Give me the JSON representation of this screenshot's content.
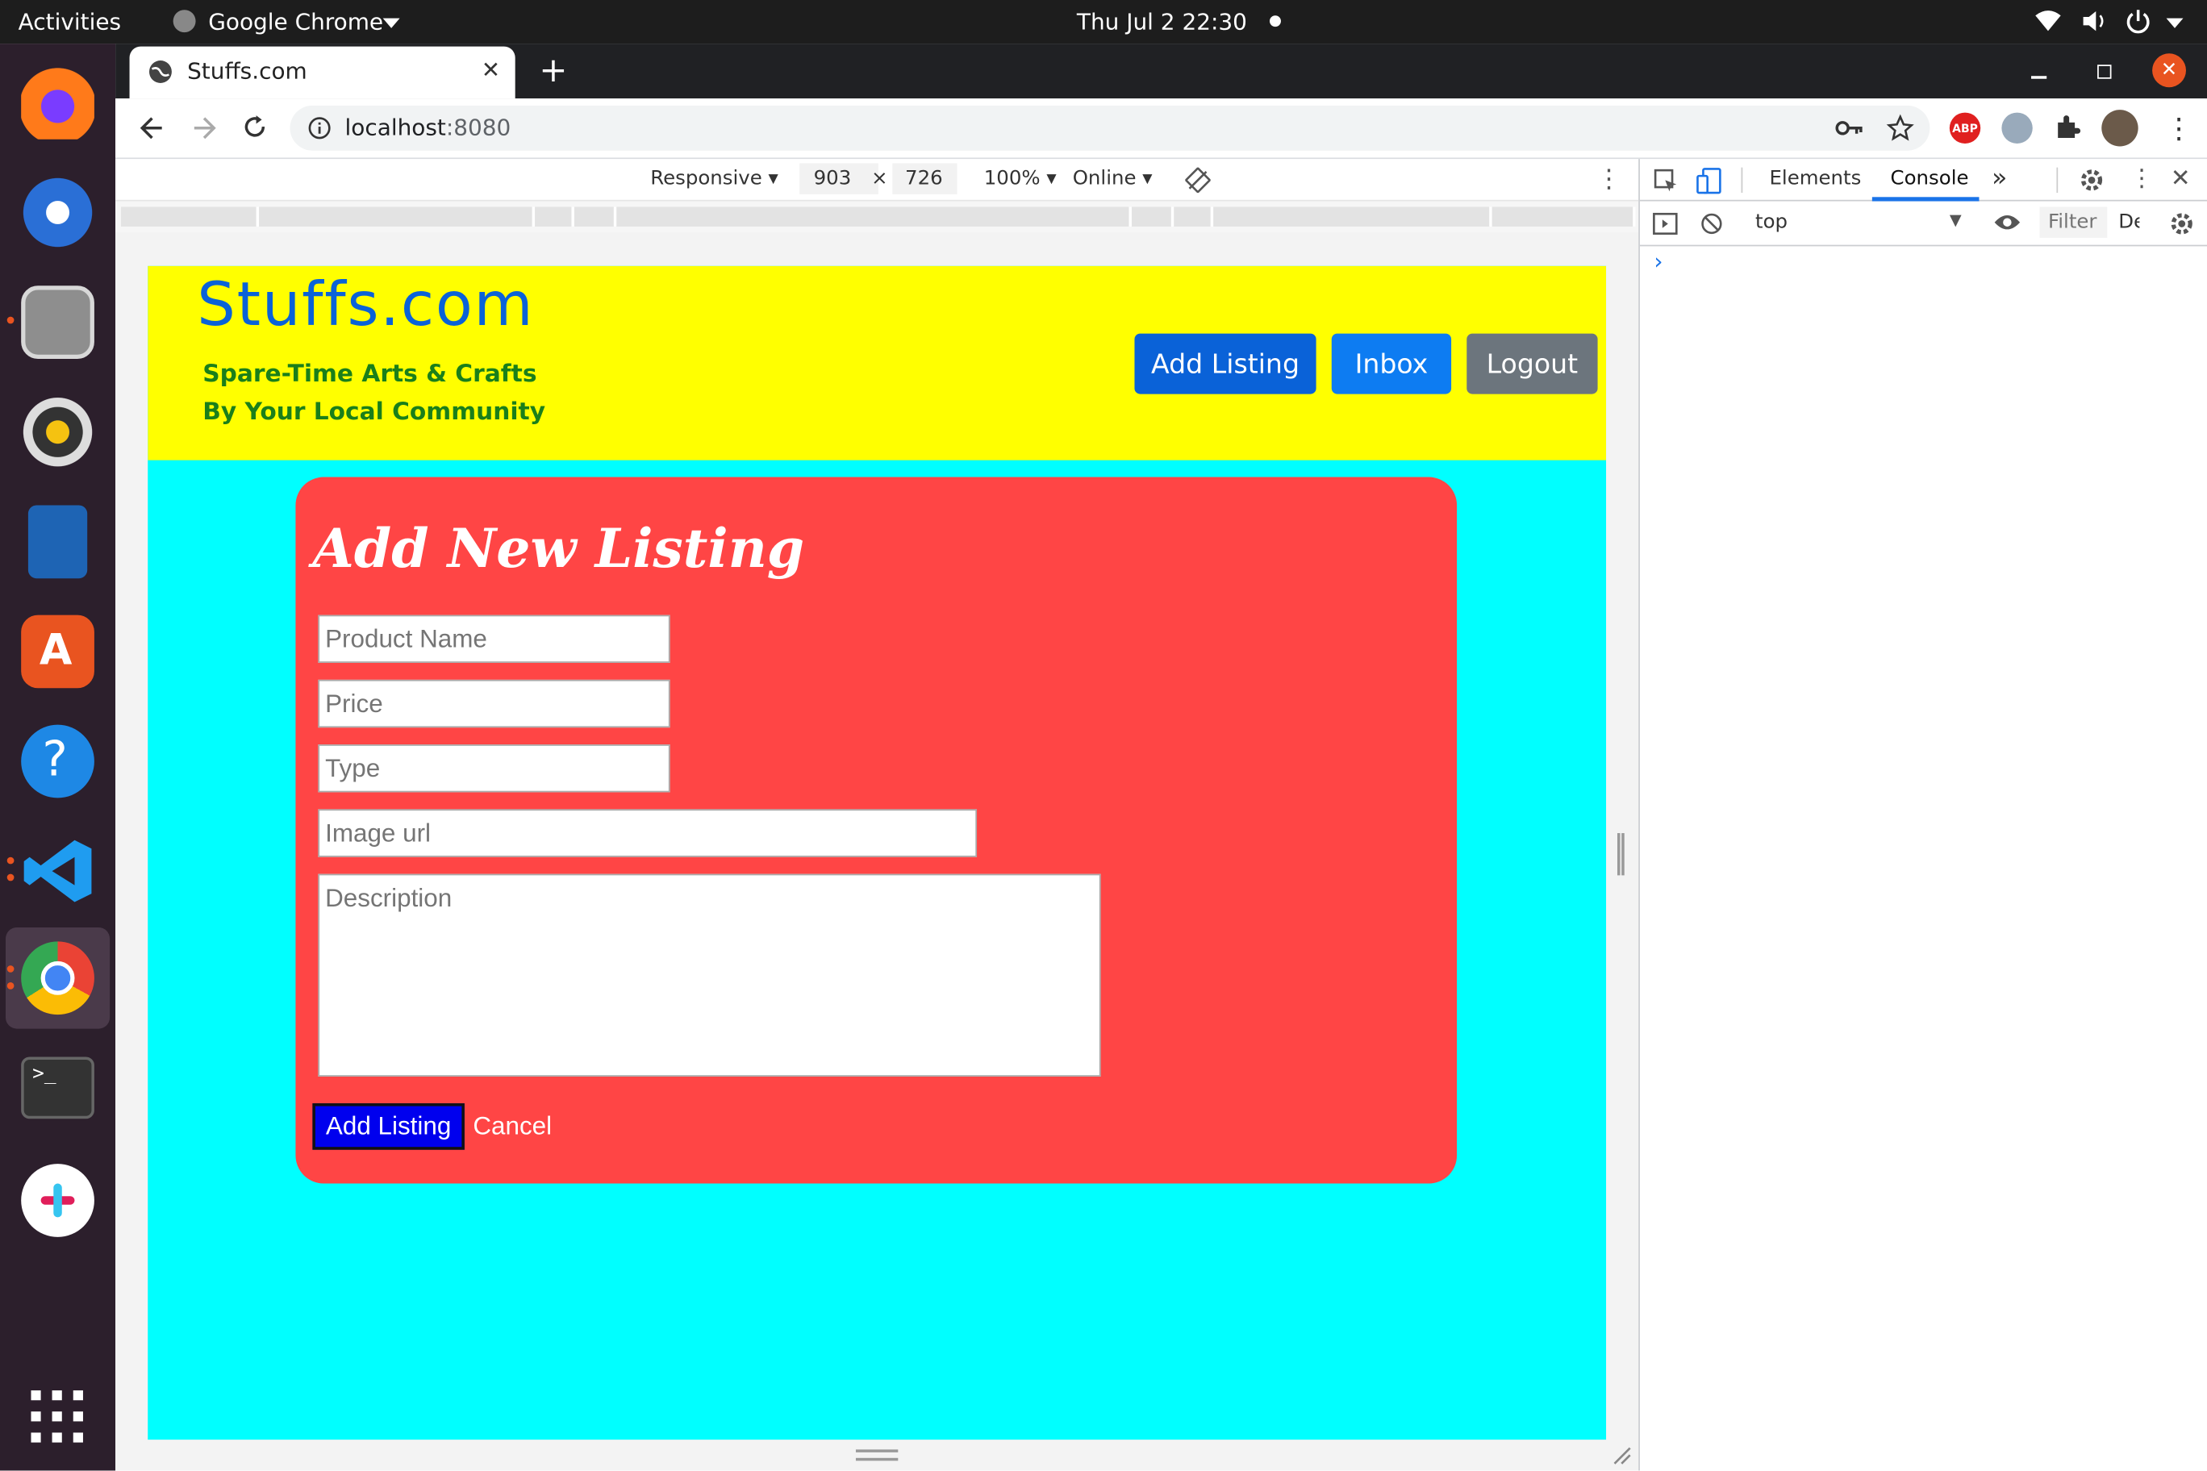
{
  "system": {
    "activities": "Activities",
    "app_name": "Google Chrome",
    "datetime": "Thu Jul 2  22:30"
  },
  "browser": {
    "tab_title": "Stuffs.com",
    "url_host": "localhost",
    "url_port": ":8080"
  },
  "device_toolbar": {
    "device": "Responsive",
    "width": "903",
    "times": "×",
    "height": "726",
    "zoom": "100%",
    "throttle": "Online"
  },
  "site": {
    "brand": "Stuffs.com",
    "tagline_1": "Spare-Time Arts & Crafts",
    "tagline_2": "By Your Local Community",
    "nav": {
      "add_listing": "Add Listing",
      "inbox": "Inbox",
      "logout": "Logout"
    }
  },
  "form": {
    "title": "Add New Listing",
    "product_name_placeholder": "Product Name",
    "price_placeholder": "Price",
    "type_placeholder": "Type",
    "image_url_placeholder": "Image url",
    "description_placeholder": "Description",
    "submit": "Add Listing",
    "cancel": "Cancel"
  },
  "devtools": {
    "tab_elements": "Elements",
    "tab_console": "Console",
    "more_tabs": "»",
    "context": "top",
    "filter_placeholder": "Filter",
    "levels": "De",
    "prompt": "›"
  },
  "colors": {
    "header_bg": "#ffff00",
    "page_bg": "#00ffff",
    "card_bg": "#ff4545",
    "brand": "#0a62d8",
    "tagline": "#1a7f1a",
    "btn_add": "#0a62d8",
    "btn_inbox": "#0d7cf2",
    "btn_logout": "#6c757d",
    "submit_bg": "#0000ee"
  }
}
